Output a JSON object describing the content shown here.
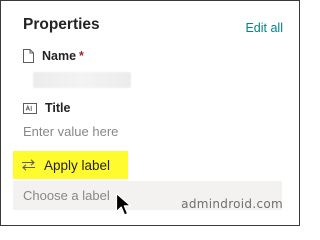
{
  "panel": {
    "title": "Properties",
    "edit_all": "Edit all"
  },
  "fields": {
    "name": {
      "label": "Name",
      "required_marker": "*",
      "icon": "document-icon"
    },
    "title": {
      "label": "Title",
      "placeholder": "Enter value here",
      "icon": "text-field-icon"
    },
    "label": {
      "apply_label": "Apply label",
      "select_placeholder": "Choose a label",
      "icon": "swap-arrows-icon"
    }
  },
  "watermark": "admindroid.com",
  "colors": {
    "accent": "#038387",
    "required": "#a4262c",
    "highlight": "#fffb2e",
    "select_background": "#f3f2f1"
  }
}
